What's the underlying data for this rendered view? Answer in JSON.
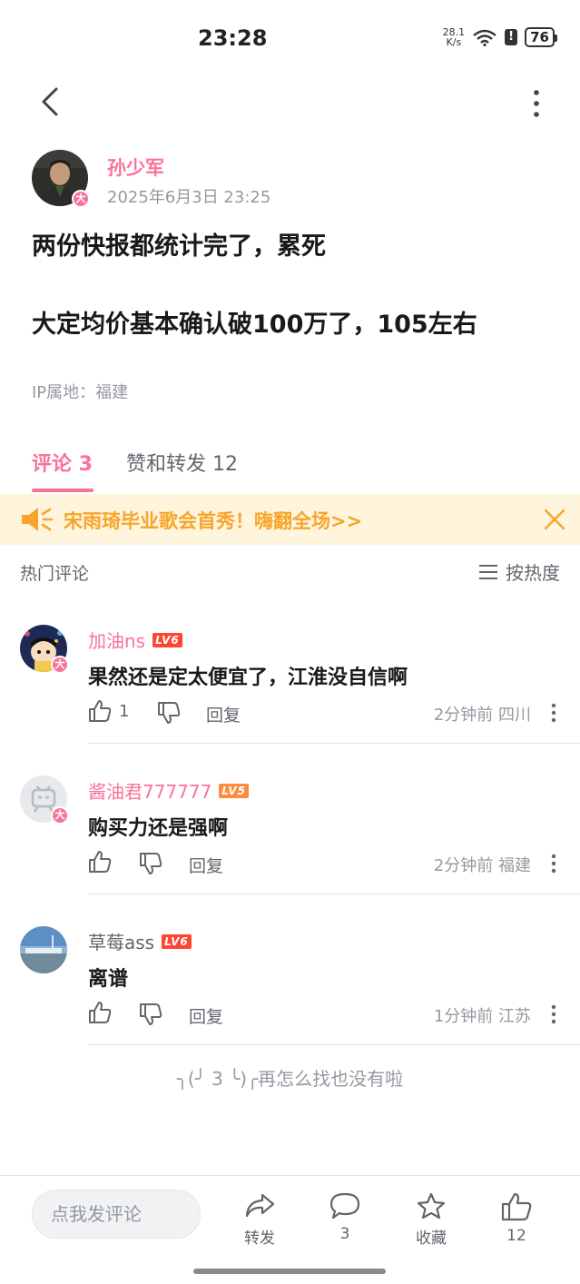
{
  "status_bar": {
    "time": "23:28",
    "net_speed_value": "28.1",
    "net_speed_unit": "K/s",
    "alert": "!",
    "battery": "76"
  },
  "post": {
    "author": "孙少军",
    "timestamp": "2025年6月3日 23:25",
    "vip_badge": "大",
    "lines": [
      "两份快报都统计完了，累死",
      "大定均价基本确认破100万了，105左右"
    ],
    "ip_location": "IP属地：福建"
  },
  "tabs": {
    "comments": "评论 3",
    "reposts": "赞和转发 12"
  },
  "banner": {
    "text": "宋雨琦毕业歌会首秀！嗨翻全场>>"
  },
  "comments_section": {
    "title": "热门评论",
    "sort_label": "按热度"
  },
  "comments": [
    {
      "user": "加油ns",
      "level": "LV6",
      "text": "果然还是定太便宜了，江淮没自信啊",
      "likes": "1",
      "reply": "回复",
      "meta": "2分钟前 四川",
      "vip": "大"
    },
    {
      "user": "酱油君777777",
      "level": "LV5",
      "text": "购买力还是强啊",
      "likes": "",
      "reply": "回复",
      "meta": "2分钟前 福建",
      "vip": "大"
    },
    {
      "user": "草莓ass",
      "level": "LV6",
      "text": "离谱",
      "likes": "",
      "reply": "回复",
      "meta": "1分钟前 江苏",
      "vip": ""
    }
  ],
  "end_hint": "╮(╯ 3 ╰)╭再怎么找也没有啦",
  "bottom_bar": {
    "input_placeholder": "点我发评论",
    "repost_label": "转发",
    "comment_count": "3",
    "favorite_label": "收藏",
    "like_count": "12"
  },
  "colors": {
    "accent_pink": "#fb7299",
    "banner_bg": "#fff4dc",
    "banner_text": "#f8a52a",
    "lv6": "#ff4530",
    "lv5": "#ff8b3f"
  },
  "icons": [
    "back-arrow-icon",
    "more-vertical-icon",
    "speaker-icon",
    "close-icon",
    "sort-lines-icon",
    "thumb-up-icon",
    "thumb-down-icon",
    "more-vertical-icon",
    "share-icon",
    "comment-bubble-icon",
    "star-icon",
    "thumb-up-icon"
  ]
}
